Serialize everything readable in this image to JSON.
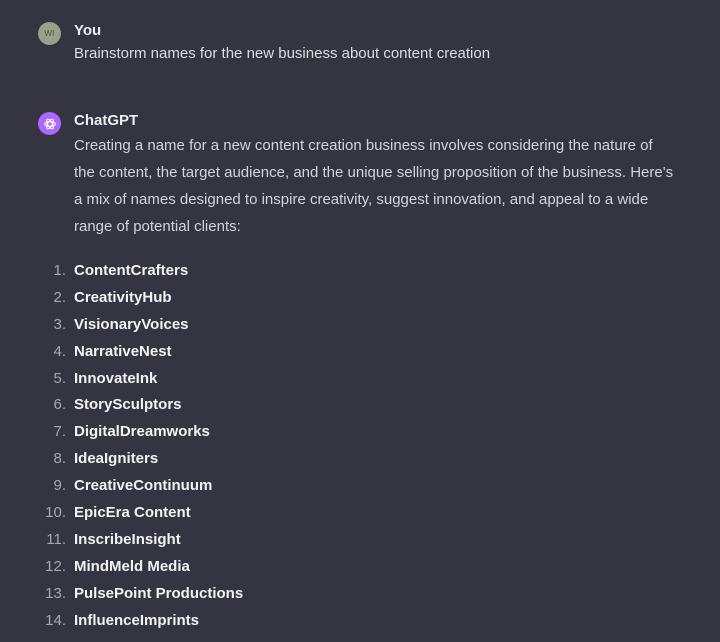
{
  "user_message": {
    "avatar_initials": "WI",
    "author": "You",
    "text": "Brainstorm names for the new business about content creation"
  },
  "assistant_message": {
    "avatar_icon": "openai-logo-icon",
    "author": "ChatGPT",
    "intro": "Creating a name for a new content creation business involves considering the nature of the content, the target audience, and the unique selling proposition of the business. Here's a mix of names designed to inspire creativity, suggest innovation, and appeal to a wide range of potential clients:",
    "names": [
      {
        "number": "1.",
        "name": "ContentCrafters"
      },
      {
        "number": "2.",
        "name": "CreativityHub"
      },
      {
        "number": "3.",
        "name": "VisionaryVoices"
      },
      {
        "number": "4.",
        "name": "NarrativeNest"
      },
      {
        "number": "5.",
        "name": "InnovateInk"
      },
      {
        "number": "6.",
        "name": "StorySculptors"
      },
      {
        "number": "7.",
        "name": "DigitalDreamworks"
      },
      {
        "number": "8.",
        "name": "IdeaIgniters"
      },
      {
        "number": "9.",
        "name": "CreativeContinuum"
      },
      {
        "number": "10.",
        "name": "EpicEra Content"
      },
      {
        "number": "11.",
        "name": "InscribeInsight"
      },
      {
        "number": "12.",
        "name": "MindMeld Media"
      },
      {
        "number": "13.",
        "name": "PulsePoint Productions"
      },
      {
        "number": "14.",
        "name": "InfluenceImprints"
      }
    ]
  },
  "colors": {
    "background": "#343541",
    "gpt_avatar": "#ab68ff",
    "user_avatar": "#9ca08a"
  }
}
